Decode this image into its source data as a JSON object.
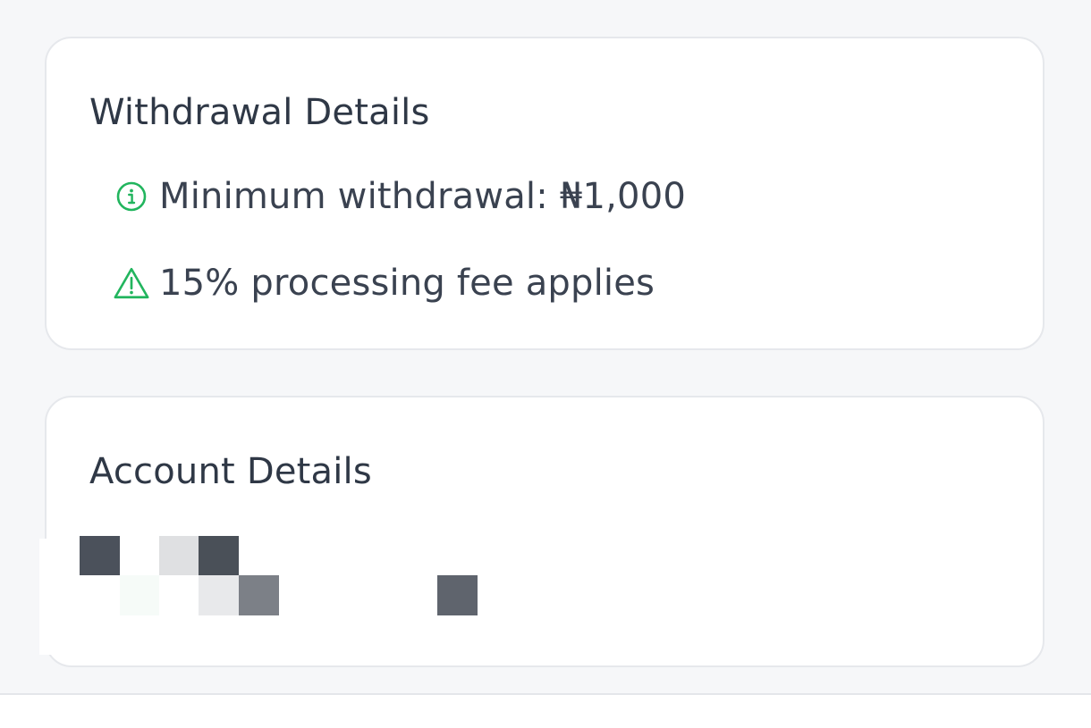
{
  "withdrawal": {
    "title": "Withdrawal Details",
    "minimum_text": "Minimum withdrawal: ₦1,000",
    "minimum_icon": "info-circle-icon",
    "fee_text": "15% processing fee applies",
    "fee_icon": "warning-triangle-icon",
    "icon_color": "#22b55e"
  },
  "account": {
    "title": "Account Details"
  }
}
